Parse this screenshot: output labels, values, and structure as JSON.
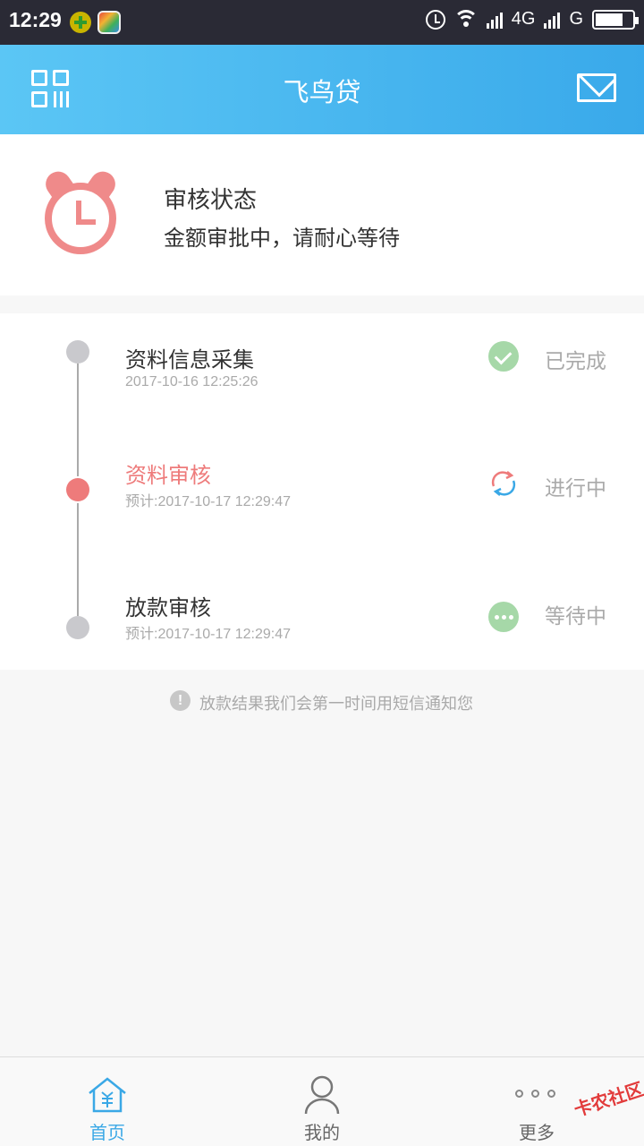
{
  "status_bar": {
    "time": "12:29",
    "network_label": "4G",
    "network_label_2": "G"
  },
  "header": {
    "title": "飞鸟贷"
  },
  "review": {
    "title": "审核状态",
    "subtitle": "金额审批中，请耐心等待"
  },
  "steps": [
    {
      "name": "资料信息采集",
      "time": "2017-10-16 12:25:26",
      "status": "已完成",
      "state": "done"
    },
    {
      "name": "资料审核",
      "time": "预计:2017-10-17 12:29:47",
      "status": "进行中",
      "state": "active"
    },
    {
      "name": "放款审核",
      "time": "预计:2017-10-17 12:29:47",
      "status": "等待中",
      "state": "waiting"
    }
  ],
  "notice": {
    "icon_text": "!",
    "text": "放款结果我们会第一时间用短信通知您"
  },
  "bottom_nav": [
    {
      "label": "首页",
      "icon": "home-icon",
      "active": true
    },
    {
      "label": "我的",
      "icon": "user-icon",
      "active": false
    },
    {
      "label": "更多",
      "icon": "more-icon",
      "active": false
    }
  ],
  "watermark": {
    "text": "卡农社区"
  },
  "colors": {
    "accent": "#3aa8e6",
    "active_step": "#ee7b7b",
    "done": "#a6d8a8",
    "header_start": "#5bc6f5",
    "header_end": "#39a9ea"
  }
}
